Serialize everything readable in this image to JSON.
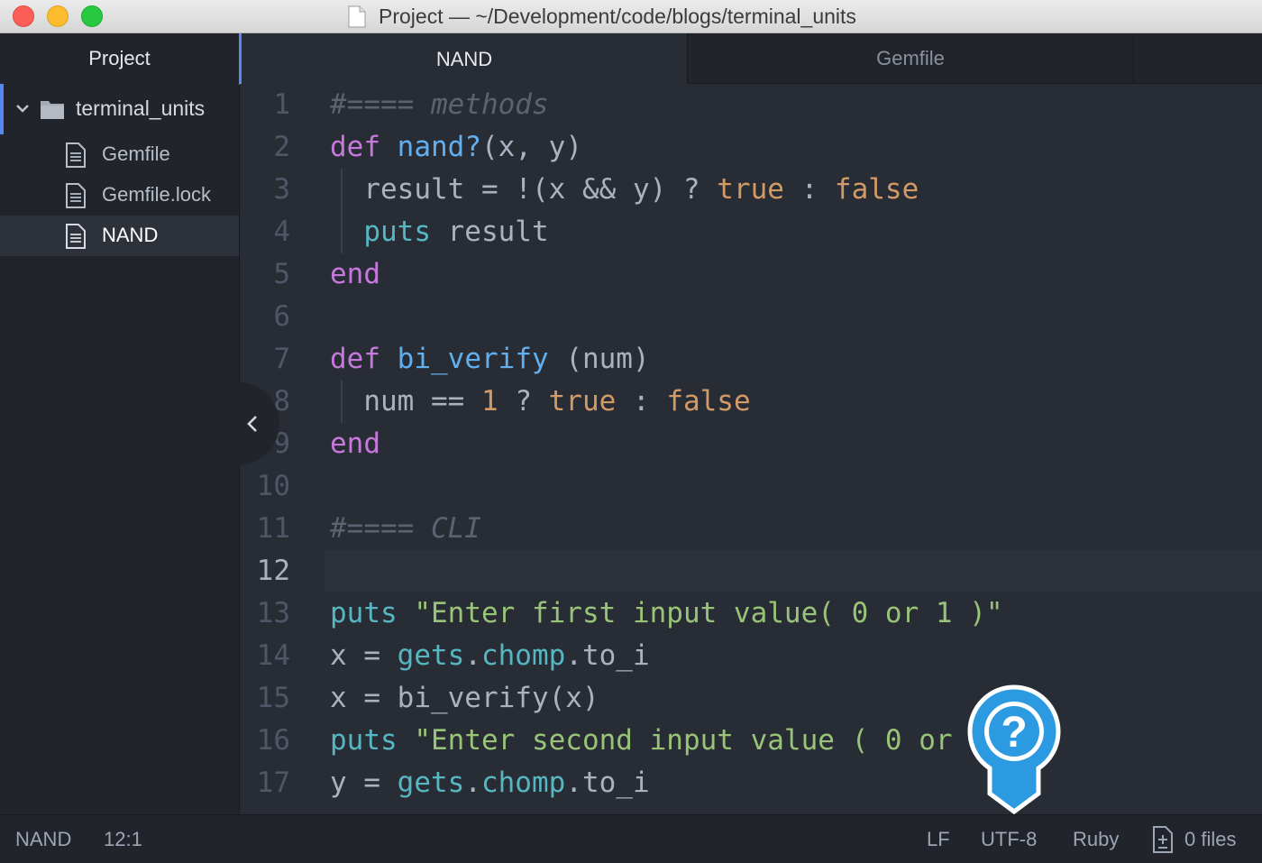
{
  "window": {
    "title": "Project — ~/Development/code/blogs/terminal_units"
  },
  "sidebar": {
    "header": "Project",
    "project_folder": "terminal_units",
    "files": [
      {
        "name": "Gemfile"
      },
      {
        "name": "Gemfile.lock"
      },
      {
        "name": "NAND"
      }
    ],
    "active_file": "NAND"
  },
  "tabs": [
    {
      "label": "NAND",
      "active": true
    },
    {
      "label": "Gemfile",
      "active": false
    }
  ],
  "editor": {
    "current_line": 12,
    "lines": [
      {
        "n": "1",
        "tokens": [
          {
            "t": "#==== methods",
            "c": "com"
          }
        ]
      },
      {
        "n": "2",
        "tokens": [
          {
            "t": "def",
            "c": "kw"
          },
          {
            "t": " ",
            "c": "txt"
          },
          {
            "t": "nand?",
            "c": "fn"
          },
          {
            "t": "(x, y)",
            "c": "txt"
          }
        ]
      },
      {
        "n": "3",
        "tokens": [
          {
            "t": "  result = !(x && y) ? ",
            "c": "txt"
          },
          {
            "t": "true",
            "c": "bool"
          },
          {
            "t": " : ",
            "c": "txt"
          },
          {
            "t": "false",
            "c": "bool"
          }
        ]
      },
      {
        "n": "4",
        "tokens": [
          {
            "t": "  ",
            "c": "txt"
          },
          {
            "t": "puts",
            "c": "puts"
          },
          {
            "t": " result",
            "c": "txt"
          }
        ]
      },
      {
        "n": "5",
        "tokens": [
          {
            "t": "end",
            "c": "kw"
          }
        ]
      },
      {
        "n": "6",
        "tokens": []
      },
      {
        "n": "7",
        "tokens": [
          {
            "t": "def",
            "c": "kw"
          },
          {
            "t": " ",
            "c": "txt"
          },
          {
            "t": "bi_verify",
            "c": "fn"
          },
          {
            "t": " (num)",
            "c": "txt"
          }
        ]
      },
      {
        "n": "8",
        "tokens": [
          {
            "t": "  num == ",
            "c": "txt"
          },
          {
            "t": "1",
            "c": "bool"
          },
          {
            "t": " ? ",
            "c": "txt"
          },
          {
            "t": "true",
            "c": "bool"
          },
          {
            "t": " : ",
            "c": "txt"
          },
          {
            "t": "false",
            "c": "bool"
          }
        ]
      },
      {
        "n": "9",
        "tokens": [
          {
            "t": "end",
            "c": "kw"
          }
        ]
      },
      {
        "n": "10",
        "tokens": []
      },
      {
        "n": "11",
        "tokens": [
          {
            "t": "#==== CLI",
            "c": "com"
          }
        ]
      },
      {
        "n": "12",
        "tokens": []
      },
      {
        "n": "13",
        "tokens": [
          {
            "t": "puts",
            "c": "puts"
          },
          {
            "t": " ",
            "c": "txt"
          },
          {
            "t": "\"Enter first input value( 0 or 1 )\"",
            "c": "str"
          }
        ]
      },
      {
        "n": "14",
        "tokens": [
          {
            "t": "x = ",
            "c": "txt"
          },
          {
            "t": "gets",
            "c": "puts"
          },
          {
            "t": ".",
            "c": "txt"
          },
          {
            "t": "chomp",
            "c": "puts"
          },
          {
            "t": ".to_i",
            "c": "txt"
          }
        ]
      },
      {
        "n": "15",
        "tokens": [
          {
            "t": "x = bi_verify(x)",
            "c": "txt"
          }
        ]
      },
      {
        "n": "16",
        "tokens": [
          {
            "t": "puts",
            "c": "puts"
          },
          {
            "t": " ",
            "c": "txt"
          },
          {
            "t": "\"Enter second input value ( 0 or",
            "c": "str"
          }
        ]
      },
      {
        "n": "17",
        "tokens": [
          {
            "t": "y = ",
            "c": "txt"
          },
          {
            "t": "gets",
            "c": "puts"
          },
          {
            "t": ".",
            "c": "txt"
          },
          {
            "t": "chomp",
            "c": "puts"
          },
          {
            "t": ".to_i",
            "c": "txt"
          }
        ]
      }
    ]
  },
  "status_bar": {
    "file": "NAND",
    "cursor_position": "12:1",
    "line_ending": "LF",
    "encoding": "UTF-8",
    "grammar": "Ruby",
    "git_files": "0 files"
  },
  "help_button": {
    "symbol": "?"
  },
  "colors": {
    "accent": "#568af2",
    "keyword": "#c678dd",
    "function": "#61afef",
    "string": "#98c379",
    "constant": "#d19a66",
    "builtin": "#56b6c2",
    "comment": "#5c6370"
  }
}
